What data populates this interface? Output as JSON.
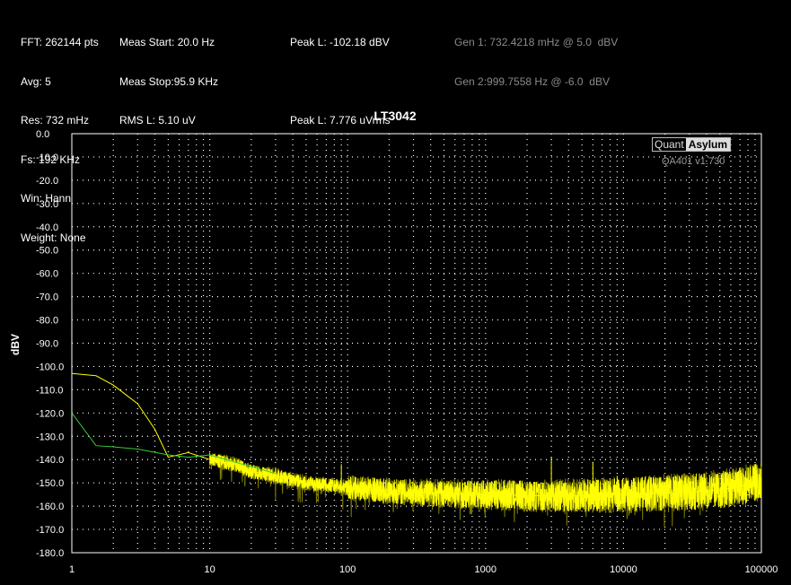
{
  "info": {
    "col1": [
      "FFT: 262144 pts",
      "Avg: 5",
      "Res: 732 mHz",
      "Fs: 192 KHz",
      "Win: Hann",
      "Weight: None"
    ],
    "col2": [
      "Meas Start: 20.0 Hz",
      "Meas Stop:95.9 KHz",
      "RMS L: 5.10 uV"
    ],
    "col3": [
      "Peak L: -102.18 dBV",
      "",
      "Peak L: 7.776 uVrms"
    ],
    "gen": [
      "Gen 1: 732.4218 mHz @ 5.0  dBV",
      "Gen 2:999.7558 Hz @ -6.0  dBV"
    ]
  },
  "branding": {
    "logo_left": "Quant",
    "logo_right": "Asylum",
    "version": "QA401 v1.730"
  },
  "colors": {
    "trace_main": "#ffff00",
    "trace_secondary": "#33cc33",
    "trace_dark": "#808000",
    "grid": "#ffffff",
    "background": "#000000"
  },
  "chart_data": {
    "type": "line",
    "title": "LT3042",
    "xlabel": "",
    "ylabel": "dBV",
    "xscale": "log",
    "xlim": [
      1,
      100000
    ],
    "ylim": [
      -180,
      0
    ],
    "grid": true,
    "x_ticks": [
      "1",
      "10",
      "100",
      "1000",
      "10000",
      "100000"
    ],
    "y_ticks": [
      "0.0",
      "-10.0",
      "-20.0",
      "-30.0",
      "-40.0",
      "-50.0",
      "-60.0",
      "-70.0",
      "-80.0",
      "-90.0",
      "-100.0",
      "-110.0",
      "-120.0",
      "-130.0",
      "-140.0",
      "-150.0",
      "-160.0",
      "-170.0",
      "-180.0"
    ],
    "series": [
      {
        "name": "",
        "color": "#ffff00",
        "x": [
          1,
          1.5,
          2,
          3,
          4,
          5,
          7,
          10,
          15,
          20,
          30,
          50,
          70,
          100,
          150,
          200,
          300,
          500,
          700,
          1000,
          2000,
          3000,
          5000,
          7000,
          10000,
          20000,
          30000,
          50000,
          70000,
          90000
        ],
        "y": [
          -103,
          -104,
          -108,
          -116,
          -127,
          -139,
          -137,
          -140,
          -142,
          -145,
          -147,
          -150,
          -151,
          -152,
          -153,
          -153.5,
          -154,
          -154.5,
          -155,
          -155,
          -155.5,
          -155.5,
          -155.5,
          -155.5,
          -155,
          -154.5,
          -154,
          -153,
          -151.5,
          -150
        ]
      },
      {
        "name": "",
        "color": "#33cc33",
        "x": [
          1,
          1.5,
          2,
          3,
          5,
          7,
          10,
          15,
          20,
          30
        ],
        "y": [
          -120,
          -134,
          -134.5,
          -135.5,
          -138,
          -139,
          -138,
          -141,
          -143,
          -146
        ]
      },
      {
        "name": "",
        "color": "#ffff00",
        "x": [
          90,
          3000,
          6000,
          9000,
          12000,
          15000
        ],
        "y": [
          -142,
          -139,
          -141,
          -147,
          -148,
          -149
        ]
      }
    ]
  }
}
